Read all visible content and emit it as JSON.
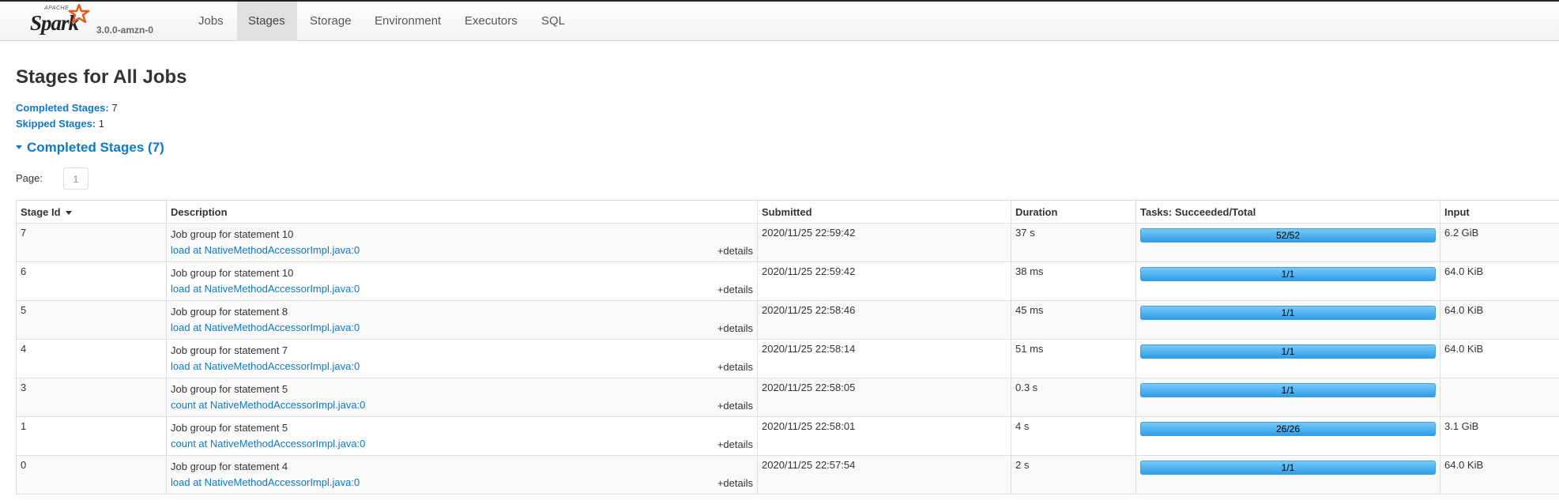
{
  "brand": {
    "apache": "APACHE",
    "name": "Spark",
    "version": "3.0.0-amzn-0"
  },
  "nav": [
    {
      "label": "Jobs",
      "active": false
    },
    {
      "label": "Stages",
      "active": true
    },
    {
      "label": "Storage",
      "active": false
    },
    {
      "label": "Environment",
      "active": false
    },
    {
      "label": "Executors",
      "active": false
    },
    {
      "label": "SQL",
      "active": false
    }
  ],
  "page": {
    "title": "Stages for All Jobs",
    "completed_label": "Completed Stages:",
    "completed_value": "7",
    "skipped_label": "Skipped Stages:",
    "skipped_value": "1",
    "section_title": "Completed Stages (7)",
    "page_label": "Page:",
    "page_value": "1"
  },
  "table": {
    "headers": [
      "Stage Id",
      "Description",
      "Submitted",
      "Duration",
      "Tasks: Succeeded/Total",
      "Input"
    ],
    "details_label": "+details",
    "rows": [
      {
        "id": "7",
        "title": "Job group for statement 10",
        "link": "load at NativeMethodAccessorImpl.java:0",
        "submitted": "2020/11/25 22:59:42",
        "duration": "37 s",
        "tasks": "52/52",
        "progress": 1.0,
        "input": "6.2 GiB"
      },
      {
        "id": "6",
        "title": "Job group for statement 10",
        "link": "load at NativeMethodAccessorImpl.java:0",
        "submitted": "2020/11/25 22:59:42",
        "duration": "38 ms",
        "tasks": "1/1",
        "progress": 1.0,
        "input": "64.0 KiB"
      },
      {
        "id": "5",
        "title": "Job group for statement 8",
        "link": "load at NativeMethodAccessorImpl.java:0",
        "submitted": "2020/11/25 22:58:46",
        "duration": "45 ms",
        "tasks": "1/1",
        "progress": 1.0,
        "input": "64.0 KiB"
      },
      {
        "id": "4",
        "title": "Job group for statement 7",
        "link": "load at NativeMethodAccessorImpl.java:0",
        "submitted": "2020/11/25 22:58:14",
        "duration": "51 ms",
        "tasks": "1/1",
        "progress": 1.0,
        "input": "64.0 KiB"
      },
      {
        "id": "3",
        "title": "Job group for statement 5",
        "link": "count at NativeMethodAccessorImpl.java:0",
        "submitted": "2020/11/25 22:58:05",
        "duration": "0.3 s",
        "tasks": "1/1",
        "progress": 1.0,
        "input": ""
      },
      {
        "id": "1",
        "title": "Job group for statement 5",
        "link": "count at NativeMethodAccessorImpl.java:0",
        "submitted": "2020/11/25 22:58:01",
        "duration": "4 s",
        "tasks": "26/26",
        "progress": 1.0,
        "input": "3.1 GiB"
      },
      {
        "id": "0",
        "title": "Job group for statement 4",
        "link": "load at NativeMethodAccessorImpl.java:0",
        "submitted": "2020/11/25 22:57:54",
        "duration": "2 s",
        "tasks": "1/1",
        "progress": 1.0,
        "input": "64.0 KiB"
      }
    ]
  },
  "colors": {
    "link": "#0d78c9",
    "progress": "#3ea0e0"
  }
}
